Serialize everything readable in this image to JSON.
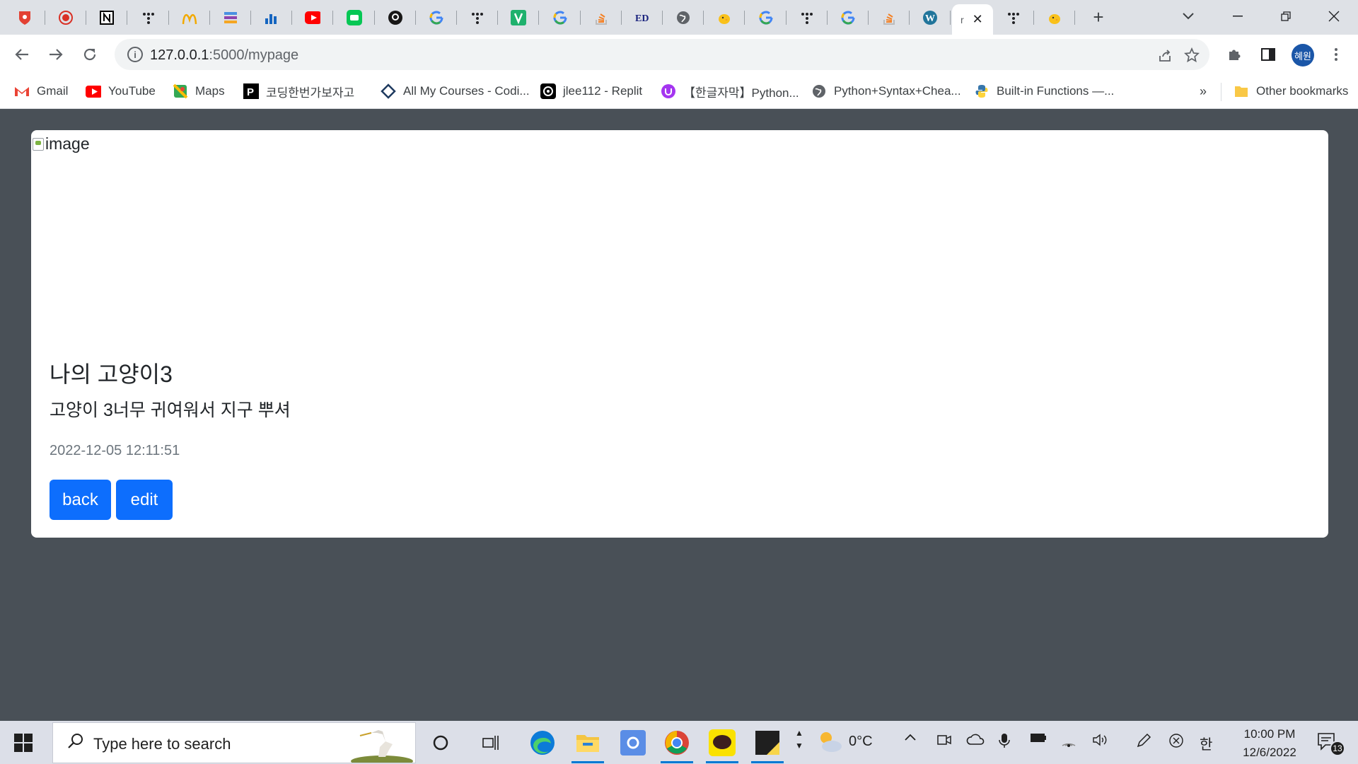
{
  "browser": {
    "tabs": [
      {
        "icon": "shield-favicon",
        "color": "#e34133"
      },
      {
        "icon": "record-favicon",
        "color": "#d93025"
      },
      {
        "icon": "notion-favicon",
        "color": "#000000"
      },
      {
        "icon": "dots-favicon",
        "color": "#202124"
      },
      {
        "icon": "mcdonalds-favicon",
        "color": "#f2a900"
      },
      {
        "icon": "layers-favicon",
        "color": "#8e44ad"
      },
      {
        "icon": "chart-favicon",
        "color": "#1565c0"
      },
      {
        "icon": "youtube-favicon",
        "color": "#ff0000"
      },
      {
        "icon": "line-favicon",
        "color": "#06c755"
      },
      {
        "icon": "github-favicon",
        "color": "#181717"
      },
      {
        "icon": "google-favicon",
        "color": "#4285f4"
      },
      {
        "icon": "dots-favicon",
        "color": "#202124"
      },
      {
        "icon": "vim-favicon",
        "color": "#1fb16d"
      },
      {
        "icon": "google-favicon",
        "color": "#4285f4"
      },
      {
        "icon": "stackoverflow-favicon",
        "color": "#f48024"
      },
      {
        "icon": "ed-favicon",
        "color": "#1a237e"
      },
      {
        "icon": "globe-favicon",
        "color": "#5f6368"
      },
      {
        "icon": "chick-favicon",
        "color": "#f9c11b"
      },
      {
        "icon": "google-favicon",
        "color": "#4285f4"
      },
      {
        "icon": "dots-favicon",
        "color": "#202124"
      },
      {
        "icon": "google-favicon",
        "color": "#4285f4"
      },
      {
        "icon": "stackoverflow-favicon",
        "color": "#f48024"
      },
      {
        "icon": "wordpress-favicon",
        "color": "#21759b"
      }
    ],
    "active_tab": {
      "label": "r"
    },
    "after_tabs": [
      {
        "icon": "dots-favicon",
        "color": "#202124"
      },
      {
        "icon": "chick-favicon",
        "color": "#f9c11b"
      }
    ],
    "url": {
      "host": "127.0.0.1",
      "path": ":5000/mypage"
    },
    "profile_label": "혜원"
  },
  "bookmarks": [
    {
      "label": "Gmail",
      "icon": "gmail-icon",
      "color": "#ea4335"
    },
    {
      "label": "YouTube",
      "icon": "youtube-icon",
      "color": "#ff0000"
    },
    {
      "label": "Maps",
      "icon": "maps-icon",
      "color": "#34a853"
    },
    {
      "label": "코딩한번가보자고",
      "icon": "p-logo-icon",
      "color": "#000000"
    },
    {
      "label": "All My Courses - Codi...",
      "icon": "diamond-icon",
      "color": "#1e3a5f"
    },
    {
      "label": "jlee112 - Replit",
      "icon": "replit-icon",
      "color": "#000000"
    },
    {
      "label": "【한글자막】Python...",
      "icon": "udemy-icon",
      "color": "#a435f0"
    },
    {
      "label": "Python+Syntax+Chea...",
      "icon": "globe-icon",
      "color": "#5f6368"
    },
    {
      "label": "Built-in Functions —...",
      "icon": "python-icon",
      "color": "#3776ab"
    }
  ],
  "bookmarks_more": "»",
  "other_bookmarks": "Other bookmarks",
  "card": {
    "image_alt": "image",
    "title": "나의 고양이3",
    "text": "고양이 3너무 귀여워서 지구 뿌셔",
    "date": "2022-12-05 12:11:51",
    "back_label": "back",
    "edit_label": "edit"
  },
  "taskbar": {
    "search_placeholder": "Type here to search",
    "weather": "0°C",
    "time": "10:00 PM",
    "date": "12/6/2022",
    "ime": "한",
    "notification_count": "13"
  },
  "colors": {
    "primary": "#0d6efd",
    "page_bg": "#495057",
    "chrome_bg": "#dee1e6"
  }
}
